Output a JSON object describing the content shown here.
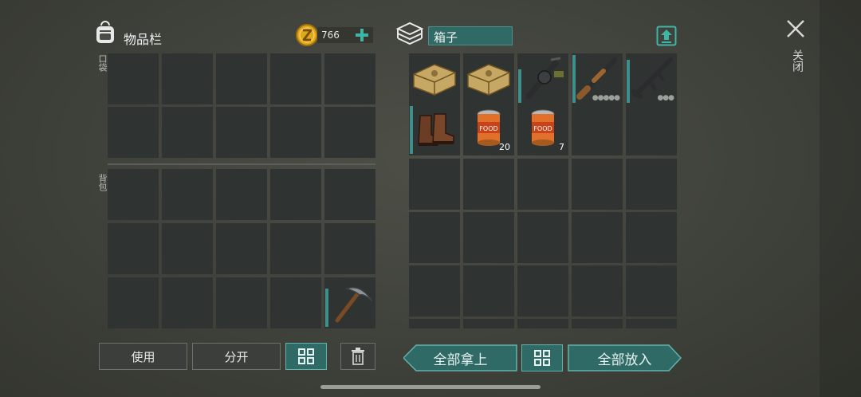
{
  "inventory": {
    "title": "物品栏",
    "coins": "766",
    "pocket_label": "口袋",
    "backpack_label": "背包",
    "actions": {
      "use": "使用",
      "split": "分开"
    },
    "items": [
      {
        "name": "pickaxe-icon",
        "slot": "backpack-row3-col5"
      }
    ]
  },
  "box": {
    "title": "箱子",
    "items": [
      {
        "name": "ammo-crate-icon"
      },
      {
        "name": "ammo-crate-icon"
      },
      {
        "name": "grenade-launcher-icon"
      },
      {
        "name": "shotgun-icon",
        "dots": "●●●●●"
      },
      {
        "name": "assault-rifle-icon",
        "dots": "●●●"
      },
      {
        "name": "boots-icon"
      },
      {
        "name": "canned-food-icon",
        "label": "FOOD",
        "qty": "20"
      },
      {
        "name": "canned-food-icon",
        "label": "FOOD",
        "qty": "7"
      }
    ],
    "take_all": "全部拿上",
    "put_all": "全部放入"
  },
  "close_label": "关闭",
  "colors": {
    "accent_teal": "#2f6a66",
    "slot": "#2f3331",
    "coin": "#e0a81c"
  }
}
